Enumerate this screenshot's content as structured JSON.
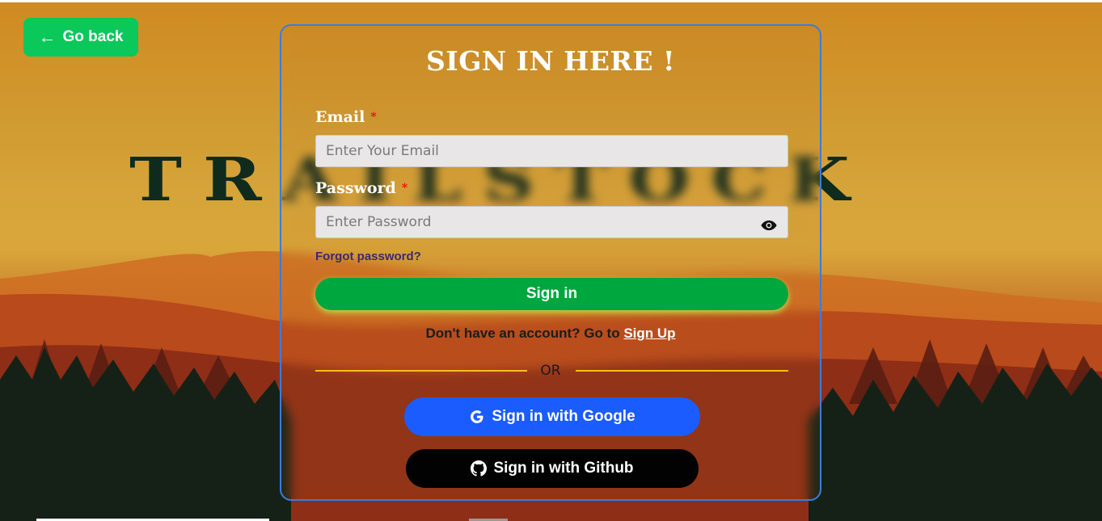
{
  "background": {
    "brand_word": "TRAILSTOCK"
  },
  "back_button": {
    "label": "Go back",
    "icon": "arrow-left-icon"
  },
  "form": {
    "title": "SIGN IN HERE !",
    "email": {
      "label": "Email",
      "required_mark": "*",
      "placeholder": "Enter Your Email",
      "value": ""
    },
    "password": {
      "label": "Password",
      "required_mark": "*",
      "placeholder": "Enter Password",
      "value": "",
      "toggle_icon": "eye-icon"
    },
    "forgot_password": "Forgot password?",
    "submit_label": "Sign in",
    "signup_prompt": "Don't have an account? Go to",
    "signup_link": "Sign Up",
    "divider_text": "OR",
    "google_button": {
      "label": "Sign in with Google",
      "icon": "google-icon"
    },
    "github_button": {
      "label": "Sign in with Github",
      "icon": "github-icon"
    }
  },
  "colors": {
    "accent_green": "#00a63e",
    "back_green": "#0bc85a",
    "google_blue": "#1b5cff",
    "github_black": "#020202",
    "card_border": "#3a7be0",
    "divider": "#f5c21b",
    "required": "#e01010"
  }
}
